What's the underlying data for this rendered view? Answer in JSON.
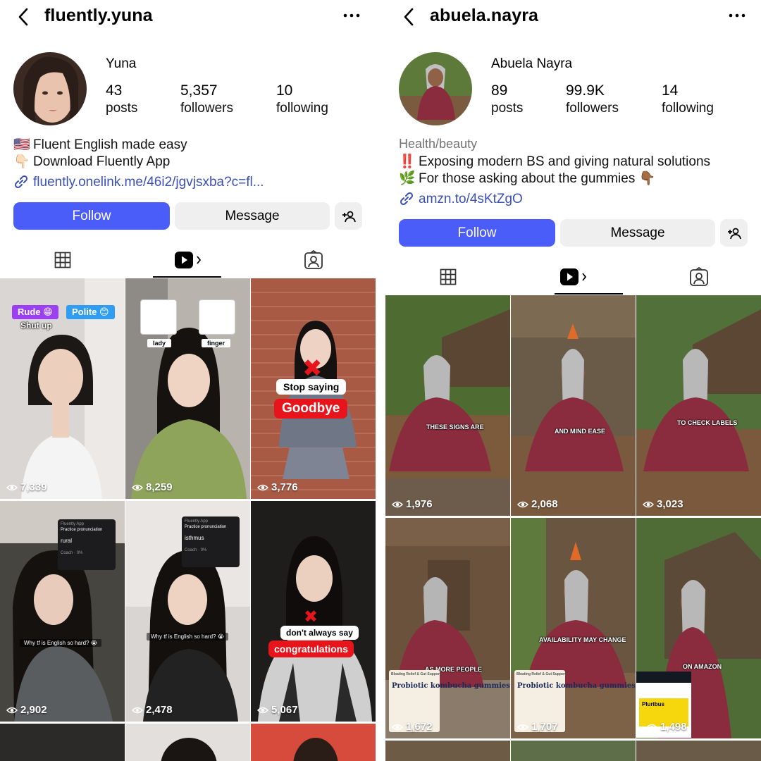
{
  "profiles": [
    {
      "username": "fluently.yuna",
      "display_name": "Yuna",
      "category": "",
      "stats": [
        {
          "num": "43",
          "label": "posts"
        },
        {
          "num": "5,357",
          "label": "followers"
        },
        {
          "num": "10",
          "label": "following"
        }
      ],
      "bio": [
        {
          "emoji": "🇺🇸",
          "text": "Fluent English made easy"
        },
        {
          "emoji": "👇🏻",
          "text": "Download Fluently App"
        }
      ],
      "link": "fluently.onelink.me/46i2/jgvjsxba?c=fl...",
      "follow_label": "Follow",
      "message_label": "Message",
      "tiles": [
        {
          "views": "7,339",
          "overlay": {
            "rude": "Rude 😁",
            "polite": "Polite 😊",
            "text": "Shut up"
          }
        },
        {
          "views": "8,259",
          "overlay": {
            "left": "lady",
            "right": "finger"
          }
        },
        {
          "views": "3,776",
          "overlay": {
            "top": "Stop saying",
            "main": "Goodbye"
          }
        },
        {
          "views": "2,902",
          "overlay": {
            "app": "Fluently App",
            "small": "Practice pronunciation",
            "word": "rural",
            "coach": "Coach",
            "score": "0%",
            "subtitle": "Why tf is English so hard? 😭"
          }
        },
        {
          "views": "2,478",
          "overlay": {
            "app": "Fluently App",
            "small": "Practice pronunciation",
            "word": "isthmus",
            "coach": "Coach",
            "score": "0%",
            "subtitle": "Why tf is English so hard? 😭"
          }
        },
        {
          "views": "5,067",
          "overlay": {
            "top": "don't always say",
            "main": "congratulations"
          }
        }
      ]
    },
    {
      "username": "abuela.nayra",
      "display_name": "Abuela Nayra",
      "category": "Health/beauty",
      "stats": [
        {
          "num": "89",
          "label": "posts"
        },
        {
          "num": "99.9K",
          "label": "followers"
        },
        {
          "num": "14",
          "label": "following"
        }
      ],
      "bio": [
        {
          "emoji": "‼️",
          "text": "Exposing modern BS and giving natural solutions"
        },
        {
          "emoji": "🌿",
          "text": "For those asking about the gummies 👇🏾"
        }
      ],
      "link": "amzn.to/4sKtZgO",
      "follow_label": "Follow",
      "message_label": "Message",
      "tiles": [
        {
          "views": "1,976",
          "overlay": {
            "caption": "THESE SIGNS ARE"
          }
        },
        {
          "views": "2,068",
          "overlay": {
            "caption": "AND MIND EASE"
          }
        },
        {
          "views": "3,023",
          "overlay": {
            "caption": "TO CHECK LABELS"
          }
        },
        {
          "views": "1,672",
          "overlay": {
            "caption": "AS MORE PEOPLE",
            "card_top": "Bloating Relief & Gut Support",
            "card_main": "Probiotic kombucha gummies"
          }
        },
        {
          "views": "1,707",
          "overlay": {
            "caption": "AVAILABILITY MAY CHANGE",
            "card_top": "Bloating Relief & Gut Support",
            "card_main": "Probiotic kombucha gummies"
          }
        },
        {
          "views": "1,498",
          "overlay": {
            "caption": "ON AMAZON",
            "card_main": "Pluribus"
          }
        }
      ]
    }
  ]
}
